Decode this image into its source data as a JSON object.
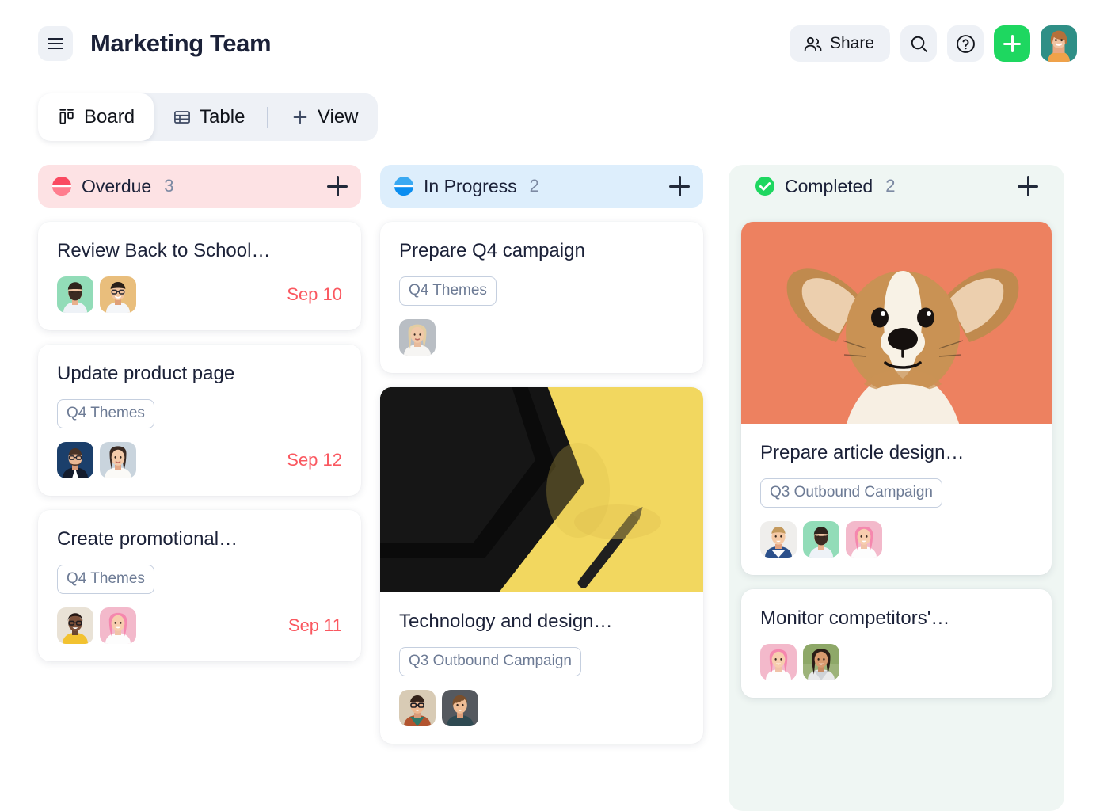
{
  "header": {
    "menu_icon": "hamburger-menu-icon",
    "title": "Marketing Team",
    "share_label": "Share",
    "share_icon": "people-icon",
    "search_icon": "search-icon",
    "help_icon": "question-mark-circle-icon",
    "add_icon": "plus-icon",
    "avatar_name": "user-avatar"
  },
  "view_tabs": [
    {
      "label": "Board",
      "icon": "board-columns-icon",
      "active": true
    },
    {
      "label": "Table",
      "icon": "table-grid-icon",
      "active": false
    },
    {
      "label": "View",
      "icon": "plus-icon",
      "active": false
    }
  ],
  "colors": {
    "overdue_header_bg": "#fde2e4",
    "overdue_dot": "#fa4a61",
    "inprogress_header_bg": "#ddeefc",
    "inprogress_dot": "#1a9cf0",
    "completed_column_bg": "#eff6f3",
    "completed_dot": "#1ed760",
    "accent_green": "#1ed760",
    "due_date_red": "#fa5860",
    "tag_border": "#c5cfdf",
    "tag_text": "#6d7b95"
  },
  "columns": [
    {
      "id": "overdue",
      "name": "Overdue",
      "count": "3",
      "status_icon": "half-filled-circle-red-icon",
      "add_icon": "plus-icon",
      "cards": [
        {
          "title": "Review Back to School…",
          "tag": null,
          "due": "Sep 10",
          "avatars": [
            "avatar-bearded-man-green",
            "avatar-man-glasses-tan"
          ],
          "cover": null
        },
        {
          "title": "Update product page",
          "tag": "Q4 Themes",
          "due": "Sep 12",
          "avatars": [
            "avatar-man-suit-navy",
            "avatar-woman-longhair-light"
          ],
          "cover": null
        },
        {
          "title": "Create promotional…",
          "tag": "Q4 Themes",
          "due": "Sep 11",
          "avatars": [
            "avatar-woman-glasses-cream",
            "avatar-woman-pinkhair"
          ],
          "cover": null
        }
      ]
    },
    {
      "id": "in-progress",
      "name": "In Progress",
      "count": "2",
      "status_icon": "half-filled-circle-blue-icon",
      "add_icon": "plus-icon",
      "cards": [
        {
          "title": "Prepare Q4 campaign",
          "tag": "Q4 Themes",
          "due": null,
          "avatars": [
            "avatar-blonde-woman-grey"
          ],
          "cover": null
        },
        {
          "title": "Technology and design…",
          "tag": "Q3 Outbound Campaign",
          "due": null,
          "avatars": [
            "avatar-man-glasses-beige",
            "avatar-man-curly-grey"
          ],
          "cover": "tablet-stylus-yellow-photo"
        }
      ]
    },
    {
      "id": "completed",
      "name": "Completed",
      "count": "2",
      "status_icon": "check-circle-green-icon",
      "add_icon": "plus-icon",
      "cards": [
        {
          "title": "Prepare article design…",
          "tag": "Q3 Outbound Campaign",
          "due": null,
          "avatars": [
            "avatar-young-man-white",
            "avatar-bearded-man-green",
            "avatar-woman-pinkhair"
          ],
          "cover": "corgi-puppy-coral-photo"
        },
        {
          "title": "Monitor competitors'…",
          "tag": null,
          "due": null,
          "avatars": [
            "avatar-woman-pinkhair",
            "avatar-woman-darkhair-green"
          ],
          "cover": null
        }
      ]
    }
  ]
}
